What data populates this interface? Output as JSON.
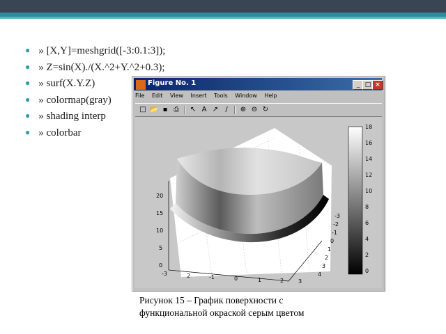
{
  "code_lines": [
    "» [X,Y]=meshgrid([-3:0.1:3]);",
    "» Z=sin(X)./(X.^2+Y.^2+0.3);",
    "» surf(X.Y.Z)",
    "» colormap(gray)",
    "» shading interp",
    "» colorbar"
  ],
  "figure_window": {
    "title": "Figure No. 1",
    "menu": [
      "File",
      "Edit",
      "View",
      "Insert",
      "Tools",
      "Window",
      "Help"
    ],
    "buttons": {
      "minimize": "_",
      "maximize": "□",
      "close": "×"
    },
    "toolbar_icons": [
      "new-icon",
      "open-icon",
      "save-icon",
      "print-icon",
      "arrow-icon",
      "text-icon",
      "arrow-line-icon",
      "line-icon",
      "zoom-in-icon",
      "zoom-out-icon",
      "rotate-icon"
    ],
    "toolbar_glyphs": [
      "□",
      "📂",
      "▪",
      "⎙",
      "↖",
      "A",
      "↗",
      "/",
      "⊕",
      "⊖",
      "↻"
    ]
  },
  "plot": {
    "z_ticks": [
      "20",
      "15",
      "10",
      "5",
      "0"
    ],
    "x_ticks": [
      "-3",
      "2",
      "-1",
      "0",
      "1",
      "2",
      "3"
    ],
    "y_ticks": [
      "4",
      "3",
      "2",
      "1",
      "0",
      "-1",
      "-2",
      "-3"
    ],
    "colorbar_ticks": [
      "18",
      "16",
      "14",
      "12",
      "10",
      "8",
      "6",
      "4",
      "2",
      "0"
    ]
  },
  "chart_data": {
    "type": "surface",
    "colormap": "gray",
    "shading": "interp",
    "zlim": [
      0,
      20
    ],
    "colorbar": {
      "range": [
        0,
        18
      ],
      "ticks": [
        0,
        2,
        4,
        6,
        8,
        10,
        12,
        14,
        16,
        18
      ]
    }
  },
  "caption": {
    "line1": "Рисунок 15 – График поверхности с",
    "line2": "функциональной окраской серым цветом"
  }
}
